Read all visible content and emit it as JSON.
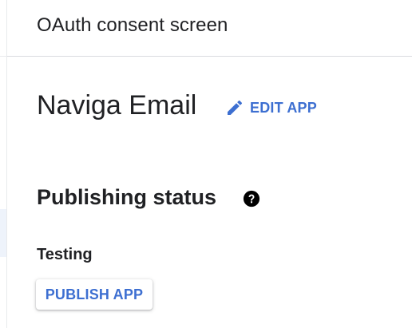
{
  "header": {
    "title": "OAuth consent screen"
  },
  "app": {
    "name": "Naviga Email",
    "edit_label": "EDIT APP",
    "edit_icon": "pencil-icon"
  },
  "publishing": {
    "heading": "Publishing status",
    "help_icon": "help-circle-icon",
    "status": "Testing",
    "publish_label": "PUBLISH APP"
  },
  "colors": {
    "accent": "#3d6fd1",
    "text": "#202124",
    "divider": "#dadce0"
  }
}
